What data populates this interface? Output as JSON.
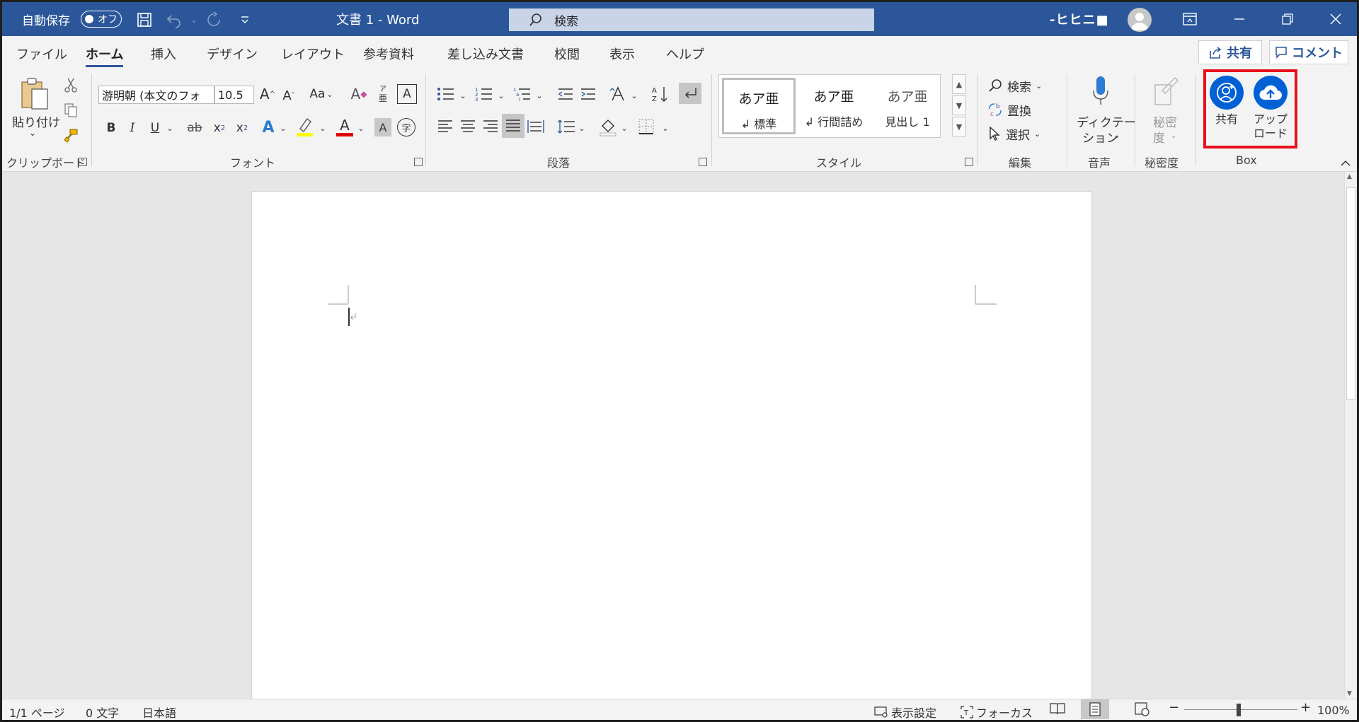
{
  "titlebar": {
    "autosave_label": "自動保存",
    "autosave_state": "オフ",
    "doc_title": "文書 1  -  Word",
    "search_label": "検索",
    "user_name": "-ヒヒニ■",
    "accent_color": "#2b579a"
  },
  "tabs": [
    "ファイル",
    "ホーム",
    "挿入",
    "デザイン",
    "レイアウト",
    "参考資料",
    "差し込み文書",
    "校閲",
    "表示",
    "ヘルプ"
  ],
  "share_label": "共有",
  "comment_label": "コメント",
  "ribbon": {
    "clipboard": {
      "paste_label": "貼り付け",
      "group_label": "クリップボード"
    },
    "font": {
      "font_name": "游明朝 (本文のフォ",
      "font_size": "10.5",
      "group_label": "フォント",
      "case_label": "Aa"
    },
    "paragraph": {
      "group_label": "段落"
    },
    "styles": {
      "group_label": "スタイル",
      "items": [
        {
          "sample": "あア亜",
          "name": "↲ 標準"
        },
        {
          "sample": "あア亜",
          "name": "↲ 行間詰め"
        },
        {
          "sample": "あア亜",
          "name": "見出し 1"
        }
      ]
    },
    "editing": {
      "find_label": "検索",
      "replace_label": "置換",
      "select_label": "選択",
      "group_label": "編集"
    },
    "voice": {
      "dictate_label_1": "ディクテー",
      "dictate_label_2": "ション",
      "group_label": "音声"
    },
    "sensitivity": {
      "label_1": "秘密",
      "label_2": "度",
      "group_label": "秘密度"
    },
    "box": {
      "share_label": "共有",
      "upload_label_1": "アップ",
      "upload_label_2": "ロード",
      "group_label": "Box",
      "brand_color": "#0061d5",
      "highlight_color": "#e8101c"
    }
  },
  "status": {
    "page": "1/1 ページ",
    "words": "0 文字",
    "language": "日本語",
    "display_settings": "表示設定",
    "focus": "フォーカス",
    "zoom": "100%"
  }
}
